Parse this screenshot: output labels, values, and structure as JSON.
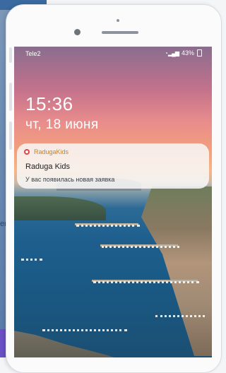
{
  "background": {
    "partial_text": "ен"
  },
  "status_bar": {
    "carrier": "Tele2",
    "battery": "43%",
    "signal_icon": "wifi-signal-icon"
  },
  "lockscreen": {
    "time": "15:36",
    "date": "чт, 18 июня"
  },
  "notification": {
    "app_name": "RadugaKids",
    "title": "Raduga Kids",
    "body": "У вас появилась новая заявка",
    "app_icon": "raduga-app-icon",
    "accent_color": "#c1822b"
  }
}
